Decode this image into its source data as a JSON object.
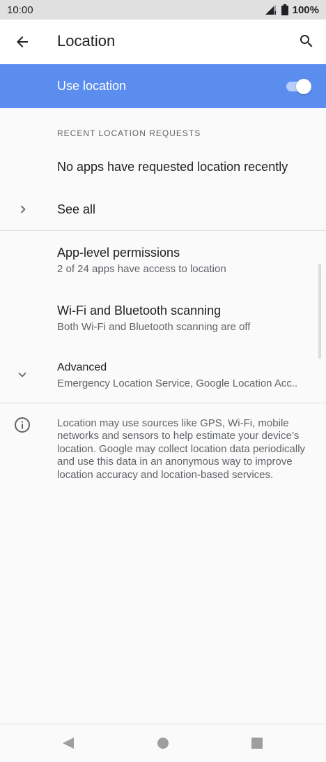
{
  "status_bar": {
    "time": "10:00",
    "battery": "100%",
    "signal_icon": "signal-icon",
    "battery_icon": "battery-icon"
  },
  "toolbar": {
    "title": "Location",
    "back_icon": "arrow-back-icon",
    "search_icon": "search-icon"
  },
  "master_switch": {
    "label": "Use location",
    "state": "on",
    "accent_color": "#5b8def"
  },
  "recent_requests": {
    "header": "RECENT LOCATION REQUESTS",
    "empty_message": "No apps have requested location recently",
    "see_all_label": "See all"
  },
  "preferences": [
    {
      "title": "App-level permissions",
      "summary": "2 of 24 apps have access to location"
    },
    {
      "title": "Wi-Fi and Bluetooth scanning",
      "summary": "Both Wi-Fi and Bluetooth scanning are off"
    },
    {
      "title": "Advanced",
      "summary": "Emergency Location Service, Google Location Acc.."
    }
  ],
  "footer": {
    "text": "Location may use sources like GPS, Wi-Fi, mobile networks and sensors to help estimate your device’s location. Google may collect location data periodically and use this data in an anonymous way to improve location accuracy and location-based services.",
    "icon": "info-icon"
  },
  "nav_bar": {
    "back_icon": "nav-back-icon",
    "home_icon": "nav-home-icon",
    "recents_icon": "nav-recents-icon"
  }
}
